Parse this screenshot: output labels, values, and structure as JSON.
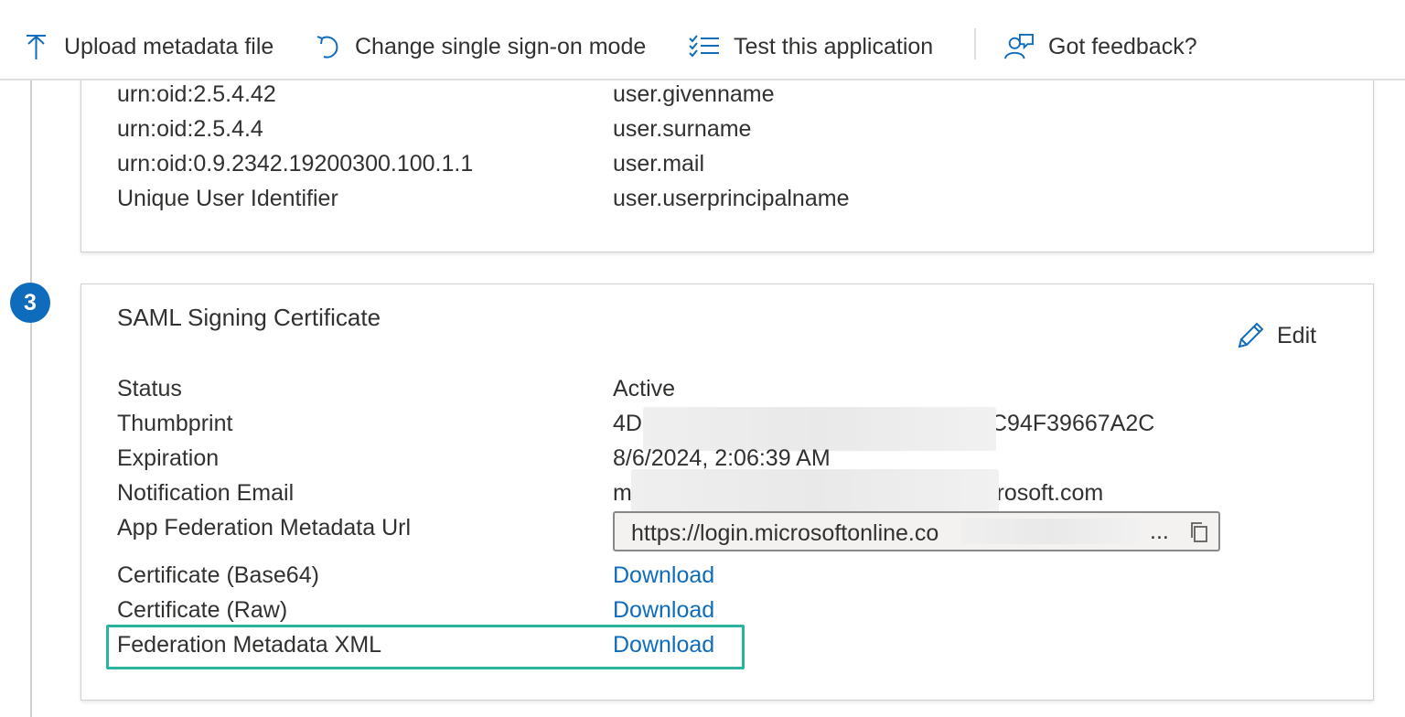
{
  "toolbar": {
    "upload_label": "Upload metadata file",
    "change_sso_label": "Change single sign-on mode",
    "test_label": "Test this application",
    "feedback_label": "Got feedback?"
  },
  "attributes_section": {
    "rows": [
      {
        "claim": "urn:oid:2.5.4.42",
        "value": "user.givenname"
      },
      {
        "claim": "urn:oid:2.5.4.4",
        "value": "user.surname"
      },
      {
        "claim": "urn:oid:0.9.2342.19200300.100.1.1",
        "value": "user.mail"
      },
      {
        "claim": "Unique User Identifier",
        "value": "user.userprincipalname"
      }
    ]
  },
  "saml_section": {
    "step_number": "3",
    "title": "SAML Signing Certificate",
    "edit_label": "Edit",
    "status_label": "Status",
    "status_value": "Active",
    "thumbprint_label": "Thumbprint",
    "thumbprint_prefix": "4D",
    "thumbprint_suffix": "C94F39667A2C",
    "expiration_label": "Expiration",
    "expiration_value": "8/6/2024, 2:06:39 AM",
    "email_label": "Notification Email",
    "email_prefix": "m",
    "email_suffix": "crosoft.com",
    "metadata_url_label": "App Federation Metadata Url",
    "metadata_url_value": "https://login.microsoftonline.co",
    "metadata_url_ellipsis": "...",
    "cert_base64_label": "Certificate (Base64)",
    "cert_raw_label": "Certificate (Raw)",
    "fed_xml_label": "Federation Metadata XML",
    "download_label": "Download"
  },
  "colors": {
    "accent": "#0f6cbd",
    "highlight": "#2bb3a0",
    "text": "#323130"
  }
}
